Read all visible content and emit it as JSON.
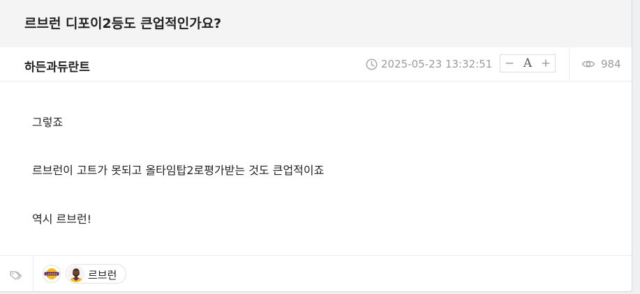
{
  "post": {
    "title": "르브런 디포이2등도 큰업적인가요?",
    "author": "하든과듀란트",
    "date": "2025-05-23 13:32:51",
    "views": "984",
    "font_controls": {
      "decrease": "−",
      "label": "A",
      "increase": "+"
    },
    "paragraphs": [
      "그렇죠",
      "르브런이 고트가 못되고 올타임탑2로평가받는 것도 큰업적이죠",
      "역시 르브런!"
    ]
  },
  "tags": {
    "team_logo_text": "LAKERS",
    "chip_label": "르브런"
  },
  "colors": {
    "accent_gold": "#f6b81a",
    "accent_purple": "#552583",
    "muted": "#9a9a9a"
  }
}
